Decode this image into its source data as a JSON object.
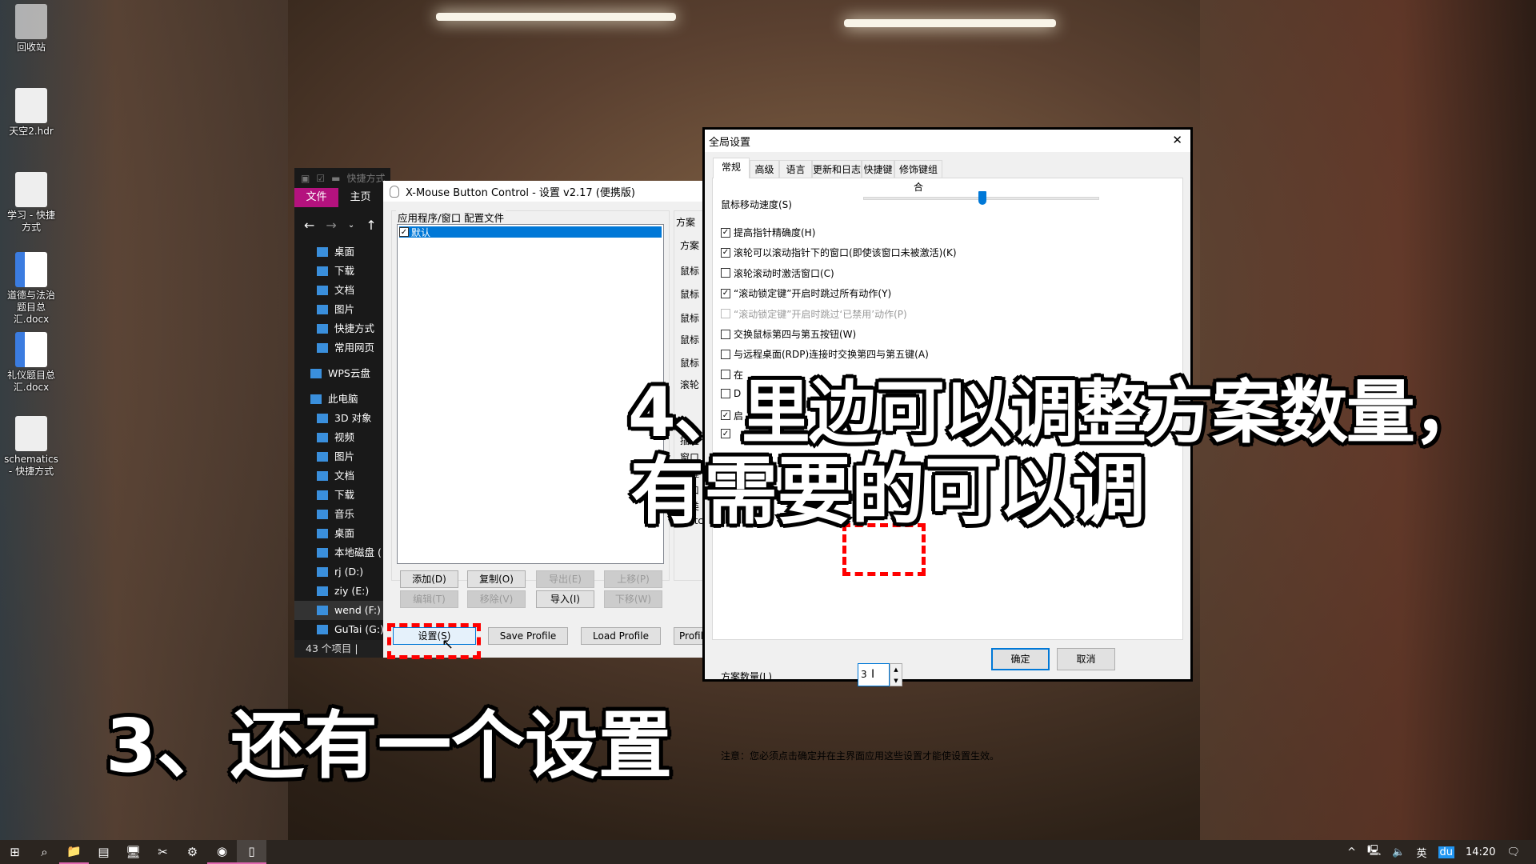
{
  "desktop": {
    "icons": [
      {
        "label": "回收站",
        "icon": "recycle-bin-icon"
      },
      {
        "label": "天空2.hdr",
        "icon": "hdr-file-icon"
      },
      {
        "label": "学习 - 快捷方式",
        "icon": "folder-shortcut-icon"
      },
      {
        "label": "道德与法治题目总汇.docx",
        "icon": "word-doc-icon"
      },
      {
        "label": "礼仪题目总汇.docx",
        "icon": "word-doc-icon"
      },
      {
        "label": "schematics - 快捷方式",
        "icon": "folder-shortcut-icon"
      }
    ]
  },
  "explorer": {
    "title": "快捷方式",
    "ribbon": [
      "文件",
      "主页"
    ],
    "nav_items": [
      "桌面",
      "下载",
      "文档",
      "图片",
      "快捷方式",
      "常用网页",
      "WPS云盘",
      "此电脑",
      "3D 对象",
      "视频",
      "图片",
      "文档",
      "下载",
      "音乐",
      "桌面",
      "本地磁盘 (",
      "rj (D:)",
      "ziy (E:)",
      "wend (F:)",
      "GuTai (G:)"
    ],
    "status": "43 个项目  |"
  },
  "xmbc": {
    "title": "X-Mouse Button Control - 设置 v2.17 (便携版)",
    "profiles_group": "应用程序/窗口 配置文件",
    "profiles": [
      {
        "label": "默认",
        "checked": true,
        "selected": true
      }
    ],
    "buttons_row1": [
      {
        "label": "添加(D)",
        "enabled": true
      },
      {
        "label": "复制(O)",
        "enabled": true
      },
      {
        "label": "导出(E)",
        "enabled": false
      },
      {
        "label": "上移(P)",
        "enabled": false
      }
    ],
    "buttons_row2": [
      {
        "label": "编辑(T)",
        "enabled": false
      },
      {
        "label": "移除(V)",
        "enabled": false
      },
      {
        "label": "导入(I)",
        "enabled": true
      },
      {
        "label": "下移(W)",
        "enabled": false
      }
    ],
    "settings_button": "设置(S)",
    "save_profile": "Save Profile",
    "load_profile": "Load Profile",
    "profile_cut": "Profil",
    "right_labels": [
      "方案",
      "方案",
      "鼠标",
      "鼠标",
      "鼠标",
      "鼠标",
      "鼠标",
      "滚轮",
      "描述",
      "窗口",
      "进程",
      "窗口",
      "父类",
      "Matc"
    ]
  },
  "dialog": {
    "title": "全局设置",
    "tabs": [
      "常规",
      "高级",
      "语言",
      "更新和日志",
      "快捷键",
      "修饰键组合"
    ],
    "active_tab": "常规",
    "mouse_speed_label": "鼠标移动速度(S)",
    "mouse_speed_value": 0.5,
    "checkboxes": [
      {
        "label": "提高指针精确度(H)",
        "checked": true,
        "enabled": true
      },
      {
        "label": "滚轮可以滚动指针下的窗口(即使该窗口未被激活)(K)",
        "checked": true,
        "enabled": true
      },
      {
        "label": "滚轮滚动时激活窗口(C)",
        "checked": false,
        "enabled": true
      },
      {
        "label": "“滚动锁定键”开启时跳过所有动作(Y)",
        "checked": true,
        "enabled": true
      },
      {
        "label": "“滚动锁定键”开启时跳过‘已禁用’动作(P)",
        "checked": false,
        "enabled": false
      },
      {
        "label": "交换鼠标第四与第五按钮(W)",
        "checked": false,
        "enabled": true
      },
      {
        "label": "与远程桌面(RDP)连接时交换第四与第五键(A)",
        "checked": false,
        "enabled": true
      },
      {
        "label": "在",
        "checked": false,
        "enabled": true
      },
      {
        "label": "D",
        "checked": false,
        "enabled": true
      },
      {
        "label": "启",
        "checked": true,
        "enabled": true
      },
      {
        "label": "",
        "checked": true,
        "enabled": true
      }
    ],
    "layers_label": "方案数量(L)",
    "layers_value": "3",
    "note": "注意：您必须点击确定并在主界面应用这些设置才能使设置生效。",
    "ok": "确定",
    "cancel": "取消",
    "close": "✕"
  },
  "captions": {
    "line1": "4、里边可以调整方案数量，",
    "line2": "有需要的可以调",
    "step3": "3、还有一个设置"
  },
  "taskbar": {
    "icons": [
      "windows-start-icon",
      "search-icon",
      "file-explorer-icon",
      "control-panel-icon",
      "remote-desktop-icon",
      "snipping-tool-icon",
      "settings-gear-icon",
      "browser-icon",
      "xmouse-icon"
    ],
    "tray": {
      "ime": "英",
      "baidu": "du",
      "time": "14:20"
    }
  },
  "colors": {
    "accent": "#0078d7",
    "highlight": "#ff0000",
    "explorer_file_tab": "#b4127e"
  }
}
